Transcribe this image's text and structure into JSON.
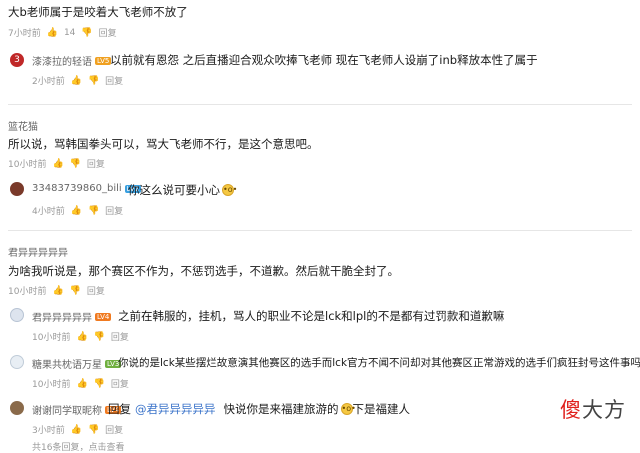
{
  "threads": [
    {
      "user": "",
      "text": "大b老师属于是咬着大飞老师不放了",
      "time": "7小时前",
      "likes": "14",
      "reply_label": "回复",
      "replies": [
        {
          "user": "漆漆拉的轻语",
          "level": "LV5",
          "text": "以前就有恩怨 之后直播迎合观众吹捧飞老师 现在飞老师人设崩了inb释放本性了属于",
          "time": "2小时前",
          "reply_label": "回复"
        }
      ]
    },
    {
      "user": "篮花猫",
      "text": "所以说，骂韩国拳头可以，骂大飞老师不行，是这个意思吧。",
      "time": "10小时前",
      "likes": "",
      "reply_label": "回复",
      "replies": [
        {
          "user": "33483739860_bili",
          "level": "LV2",
          "text": "你这么说可要小心",
          "emoji": "😮",
          "time": "4小时前",
          "reply_label": "回复"
        }
      ]
    },
    {
      "user": "君异异异异异",
      "text": "为啥我听说是，那个赛区不作为，不惩罚选手，不道歉。然后就干脆全封了。",
      "time": "10小时前",
      "likes": "",
      "reply_label": "回复",
      "replies": [
        {
          "user": "君异异异异异",
          "level": "LV4",
          "text": "之前在韩服的，挂机，骂人的职业不论是lck和lpl的不是都有过罚款和道歉嘛",
          "time": "10小时前",
          "reply_label": "回复"
        },
        {
          "user": "糖果共枕语万星",
          "level": "LV3",
          "text": "你说的是lck某些摆烂故意演其他赛区的选手而lck官方不闻不问却对其他赛区正常游戏的选手们疯狂封号这件事吗?",
          "time": "10小时前",
          "reply_label": "回复"
        },
        {
          "user": "谢谢同学取昵称",
          "level": "LV4",
          "reply_prefix": "回复",
          "mention": "@君异异异异异",
          "text": "快说你是来福建旅游的",
          "emoji": "😮",
          "text2": "下是福建人",
          "time": "3小时前",
          "reply_label": "回复"
        }
      ]
    }
  ],
  "footer_text": "共16条回复，点击查看",
  "watermark": {
    "a": "傻",
    "b": "大方"
  },
  "colors": {
    "accent": "#3a73c9",
    "watermark_red": "#e0201c"
  }
}
